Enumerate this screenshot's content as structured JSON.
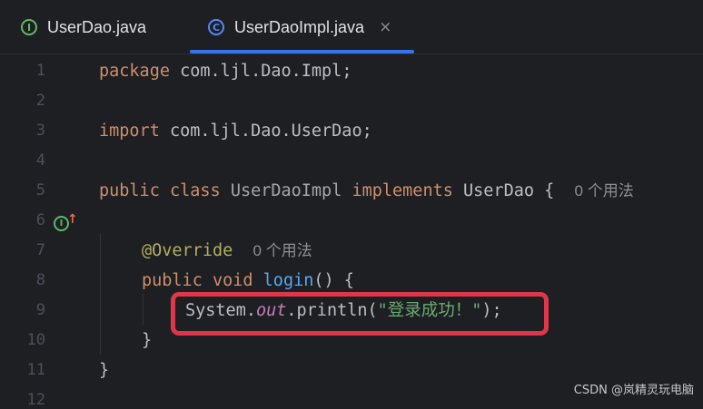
{
  "tabs": [
    {
      "icon": "interface-icon",
      "icon_glyph": "I",
      "label": "UserDao.java"
    },
    {
      "icon": "class-icon",
      "icon_glyph": "C",
      "label": "UserDaoImpl.java",
      "active": true,
      "close": "×"
    }
  ],
  "gutter": {
    "line_numbers": [
      "1",
      "2",
      "3",
      "4",
      "5",
      "6",
      "7",
      "8",
      "9",
      "10",
      "11",
      "12"
    ],
    "marker_line8": {
      "icon": "implements-method-icon",
      "glyph": "I",
      "arrow": "↑"
    }
  },
  "code": {
    "line1": {
      "kw": "package",
      "rest": " com.ljl.Dao.Impl;"
    },
    "line3": {
      "kw": "import",
      "rest": " com.ljl.Dao.UserDao;"
    },
    "line5": {
      "kw1": "public",
      "kw2": "class",
      "cls": "UserDaoImpl",
      "kw3": "implements",
      "iface": "UserDao",
      "brace": " {",
      "hint": "0 个用法"
    },
    "line7": {
      "ann": "@Override",
      "hint": "0 个用法"
    },
    "line8": {
      "kw1": "public",
      "kw2": "void",
      "fn": "login",
      "rest": "() {"
    },
    "line9": {
      "sys": "System.",
      "field": "out",
      "call": ".println(",
      "str": "\"登录成功！\"",
      "end": ");"
    },
    "line10": {
      "text": "}"
    },
    "line11": {
      "text": "}"
    }
  },
  "watermark": "CSDN @岚精灵玩电脑",
  "colors": {
    "background": "#1e1f22",
    "keyword": "#cf8e6d",
    "string": "#6aab73",
    "function": "#56a8f5",
    "annotation": "#b3ae60",
    "highlight_border": "#e0364b",
    "tab_accent": "#3574f0"
  }
}
